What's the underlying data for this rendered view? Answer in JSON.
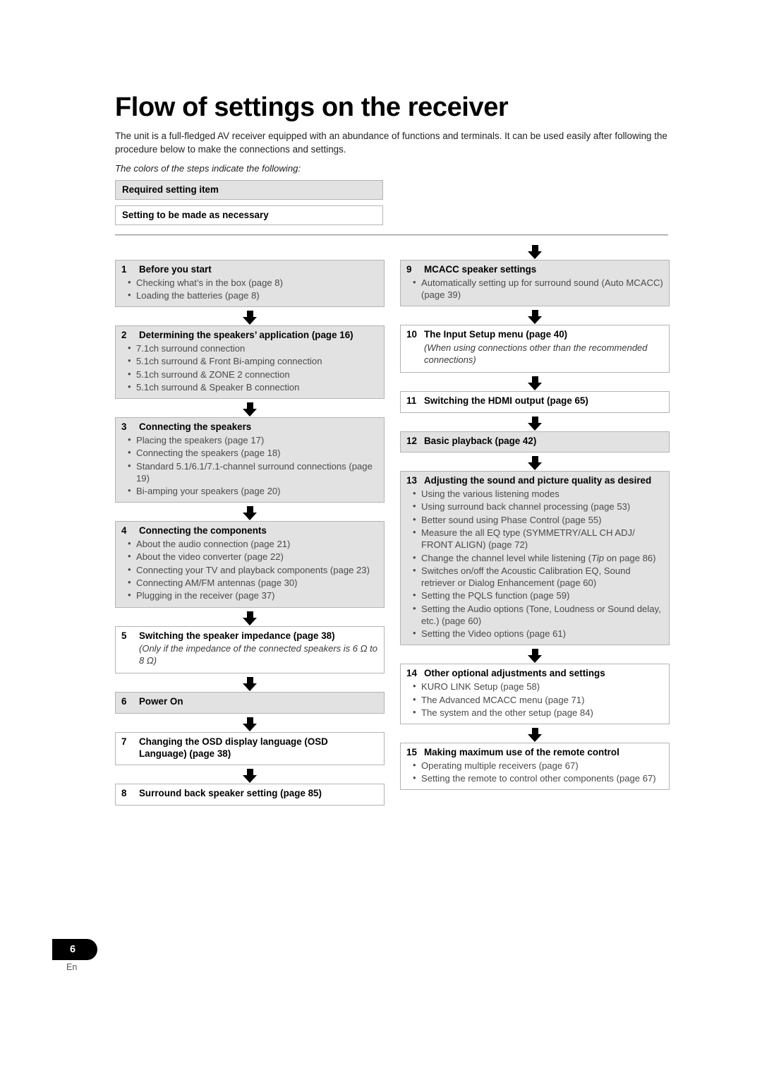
{
  "document": {
    "title": "Flow of settings on the receiver",
    "intro": "The unit is a full-fledged AV receiver equipped with an abundance of functions and terminals. It can be used easily after following the procedure below to make the connections and settings.",
    "legend_caption": "The colors of the steps indicate the following:"
  },
  "legend": {
    "required": "Required setting item",
    "optional": "Setting to be made as necessary"
  },
  "steps_left": [
    {
      "num": "1",
      "title": "Before you start",
      "filled": true,
      "bullets": [
        "Checking what’s in the box (page 8)",
        "Loading the batteries (page 8)"
      ]
    },
    {
      "num": "2",
      "title": "Determining the speakers’ application (page 16)",
      "filled": true,
      "bullets": [
        "7.1ch surround connection",
        "5.1ch surround & Front Bi-amping connection",
        "5.1ch surround & ZONE 2 connection",
        "5.1ch surround & Speaker B connection"
      ]
    },
    {
      "num": "3",
      "title": "Connecting the speakers",
      "filled": true,
      "bullets": [
        "Placing the speakers (page 17)",
        "Connecting the speakers (page 18)",
        "Standard 5.1/6.1/7.1-channel surround connections (page 19)",
        "Bi-amping your speakers (page 20)"
      ]
    },
    {
      "num": "4",
      "title": "Connecting the components",
      "filled": true,
      "bullets": [
        "About the audio connection (page 21)",
        "About the video converter (page 22)",
        "Connecting your TV and playback components (page 23)",
        "Connecting AM/FM antennas (page 30)",
        "Plugging in the receiver (page 37)"
      ]
    },
    {
      "num": "5",
      "title": "Switching the speaker impedance (page 38)",
      "filled": false,
      "note": "(Only if the impedance of the connected speakers is 6 Ω to 8 Ω)",
      "bullets": []
    },
    {
      "num": "6",
      "title": "Power On",
      "filled": true,
      "bullets": []
    },
    {
      "num": "7",
      "title": "Changing the OSD display language (OSD Language) (page 38)",
      "filled": false,
      "bullets": []
    },
    {
      "num": "8",
      "title": "Surround back speaker setting (page 85)",
      "filled": false,
      "bullets": []
    }
  ],
  "steps_right": [
    {
      "num": "9",
      "title": "MCACC speaker settings",
      "filled": true,
      "bullets": [
        "Automatically setting up for surround sound (Auto MCACC) (page 39)"
      ]
    },
    {
      "num": "10",
      "title": "The Input Setup menu (page 40)",
      "filled": false,
      "note": "(When using connections other than the recommended connections)",
      "bullets": []
    },
    {
      "num": "11",
      "title": "Switching the HDMI output (page 65)",
      "filled": false,
      "bullets": []
    },
    {
      "num": "12",
      "title": "Basic playback (page 42)",
      "filled": true,
      "bullets": []
    },
    {
      "num": "13",
      "title": "Adjusting the sound and picture quality as desired",
      "filled": true,
      "bullets": [
        "Using the various listening modes",
        "Using surround back channel processing (page 53)",
        "Better sound using Phase Control (page 55)",
        "Measure the all EQ type (SYMMETRY/ALL CH ADJ/ FRONT ALIGN) (page 72)",
        "Change the channel level while listening (Tip on page 86)",
        "Switches on/off the Acoustic Calibration EQ, Sound retriever or Dialog Enhancement (page 60)",
        "Setting the PQLS function (page 59)",
        "Setting the Audio options (Tone, Loudness or Sound delay, etc.) (page 60)",
        "Setting the Video options (page 61)"
      ]
    },
    {
      "num": "14",
      "title": "Other optional adjustments and settings",
      "filled": false,
      "bullets": [
        "KURO LINK Setup (page 58)",
        "The Advanced MCACC menu (page 71)",
        "The system and the other setup (page 84)"
      ]
    },
    {
      "num": "15",
      "title": "Making maximum use of the remote control",
      "filled": false,
      "bullets": [
        "Operating multiple receivers (page 67)",
        "Setting the remote to control other components (page 67)"
      ]
    }
  ],
  "footer": {
    "page_number": "6",
    "language": "En"
  },
  "colors": {
    "required_fill": "#e2e2e2",
    "box_border": "#b4b4b4",
    "bullet_text": "#4a4a4a",
    "heading_text": "#000000"
  }
}
